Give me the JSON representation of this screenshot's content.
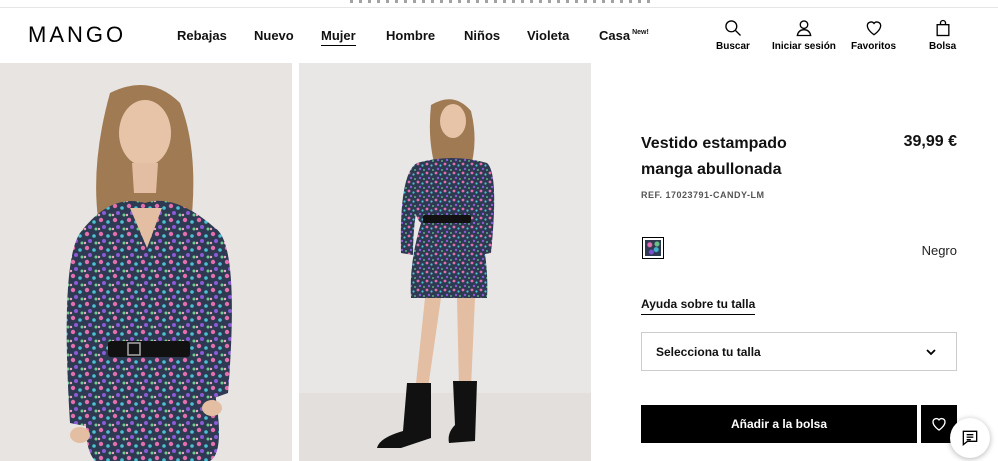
{
  "brand": {
    "logo_text": "MANGO"
  },
  "nav": {
    "items": [
      {
        "label": "Rebajas"
      },
      {
        "label": "Nuevo"
      },
      {
        "label": "Mujer"
      },
      {
        "label": "Hombre"
      },
      {
        "label": "Niños"
      },
      {
        "label": "Violeta"
      },
      {
        "label": "Casa",
        "tag": "New!"
      }
    ],
    "active": "Mujer"
  },
  "utilities": {
    "search": "Buscar",
    "login": "Iniciar sesión",
    "favorites": "Favoritos",
    "bag": "Bolsa"
  },
  "product": {
    "title": "Vestido estampado manga abullonada",
    "price": "39,99 €",
    "ref": "REF. 17023791-CANDY-LM",
    "color_name": "Negro",
    "size_help": "Ayuda sobre tu talla",
    "size_placeholder": "Selecciona tu talla",
    "add_to_bag": "Añadir a la bolsa"
  },
  "colors": {
    "accent": "#000000",
    "text": "#111111",
    "border": "#cccccc"
  }
}
